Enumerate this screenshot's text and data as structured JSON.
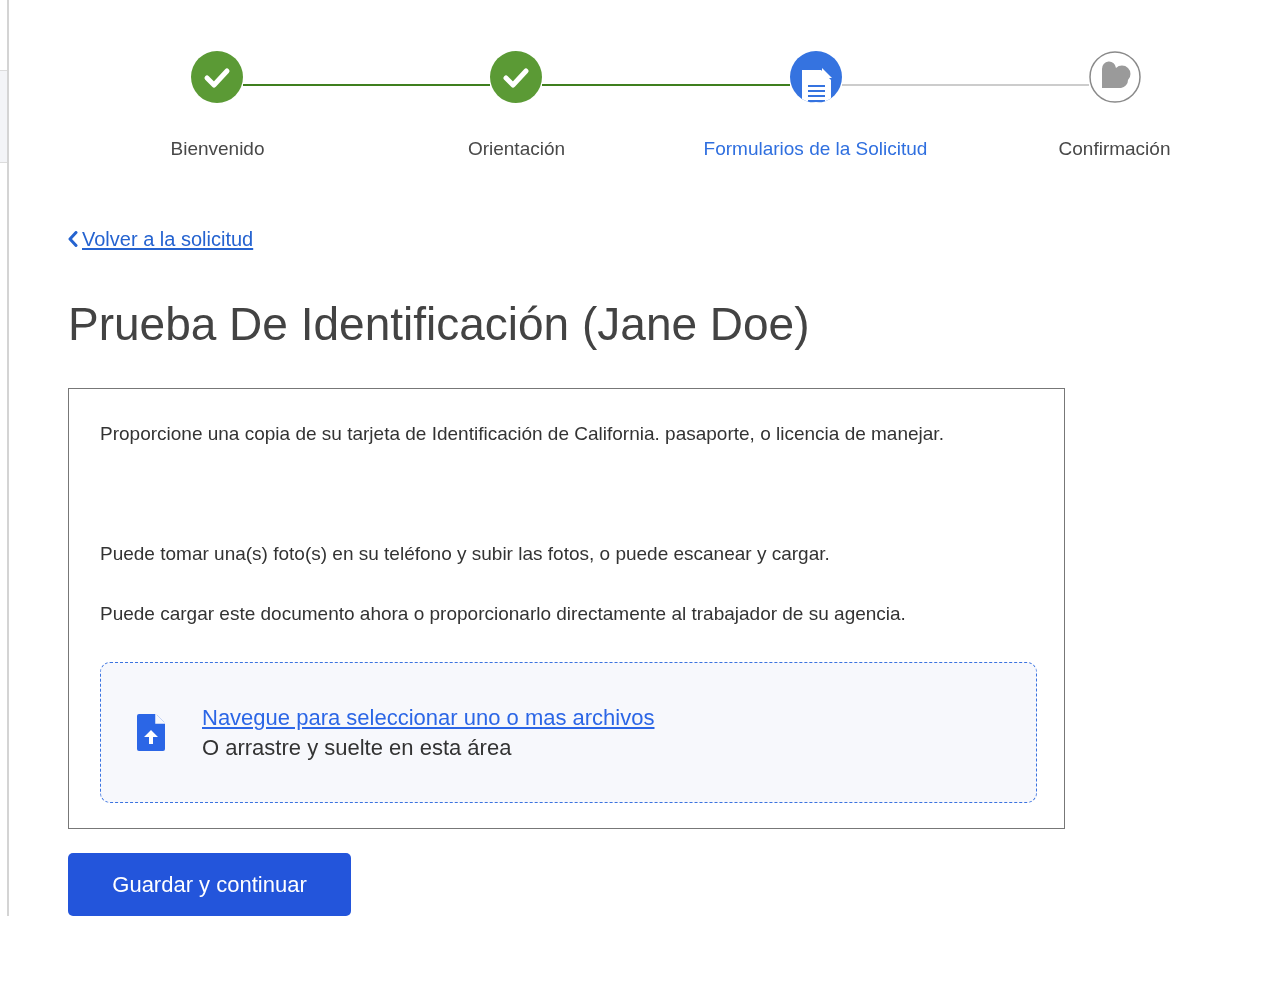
{
  "stepper": {
    "steps": [
      {
        "label": "Bienvenido",
        "completed": true,
        "selected": false
      },
      {
        "label": "Orientación",
        "completed": true,
        "selected": false
      },
      {
        "label": "Formularios de la Solicitud",
        "completed": false,
        "selected": true
      },
      {
        "label": "Confirmación",
        "completed": false,
        "selected": false
      }
    ]
  },
  "back_link": {
    "label": "Volver a la solicitud"
  },
  "title": "Prueba De Identificación (Jane Doe)",
  "instructions": {
    "paragraphs": [
      "Proporcione una copia de su tarjeta de Identificación de California. pasaporte, o licencia de manejar.",
      "Puede tomar una(s) foto(s) en su teléfono y subir las fotos, o puede escanear y cargar.",
      "Puede cargar este documento ahora o proporcionarlo directamente al trabajador de su agencia."
    ]
  },
  "upload": {
    "link": "Navegue para seleccionar uno o mas archivos",
    "hint": "O arrastre y suelte en esta área"
  },
  "primary_button": {
    "label": "Guardar y continuar"
  }
}
